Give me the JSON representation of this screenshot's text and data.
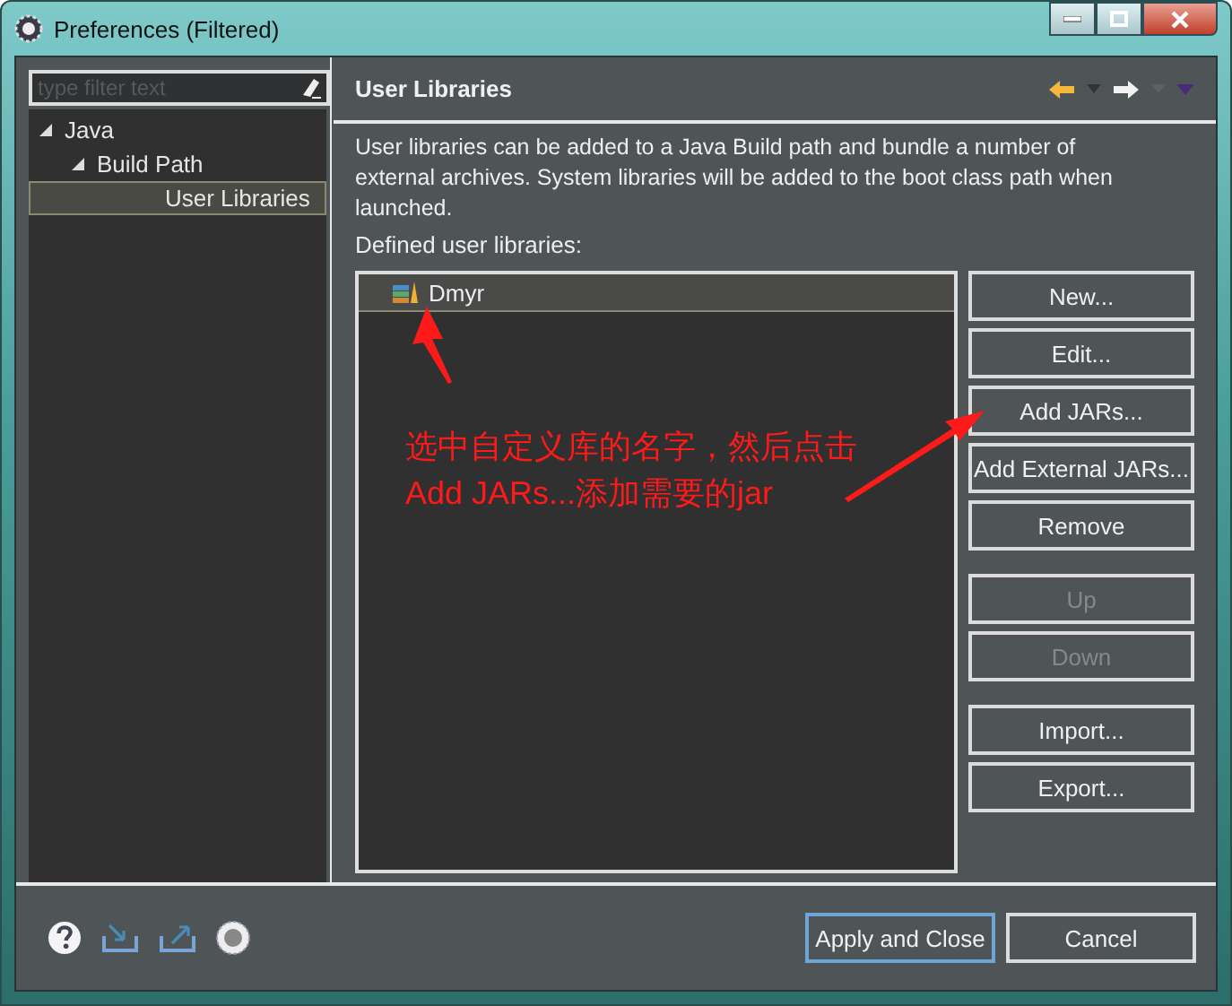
{
  "window": {
    "title": "Preferences (Filtered)"
  },
  "sidebar": {
    "filter": {
      "placeholder": "type filter text"
    },
    "tree": [
      {
        "label": "Java",
        "expanded": true,
        "selected": false,
        "children": [
          {
            "label": "Build Path",
            "expanded": true,
            "selected": false,
            "children": [
              {
                "label": "User Libraries",
                "selected": true
              }
            ]
          }
        ]
      }
    ]
  },
  "page": {
    "title": "User Libraries",
    "description": "User libraries can be added to a Java Build path and bundle a number of external archives. System libraries will be added to the boot class path when launched.",
    "list_label": "Defined user libraries:",
    "libraries": [
      {
        "name": "Dmyr",
        "selected": true
      }
    ],
    "buttons": [
      {
        "kind": "button",
        "label": "New...",
        "disabled": false
      },
      {
        "kind": "button",
        "label": "Edit...",
        "disabled": false
      },
      {
        "kind": "button",
        "label": "Add JARs...",
        "disabled": false
      },
      {
        "kind": "button",
        "label": "Add External JARs...",
        "disabled": false
      },
      {
        "kind": "button",
        "label": "Remove",
        "disabled": false
      },
      {
        "kind": "spacer"
      },
      {
        "kind": "button",
        "label": "Up",
        "disabled": true
      },
      {
        "kind": "button",
        "label": "Down",
        "disabled": true
      },
      {
        "kind": "spacer"
      },
      {
        "kind": "button",
        "label": "Import...",
        "disabled": false
      },
      {
        "kind": "button",
        "label": "Export...",
        "disabled": false
      }
    ]
  },
  "annotation": {
    "lines": [
      "选中自定义库的名字，然后点击",
      "Add JARs...添加需要的jar"
    ]
  },
  "footer": {
    "buttons": [
      {
        "label": "Apply and Close",
        "default": true
      },
      {
        "label": "Cancel",
        "default": false
      }
    ]
  }
}
